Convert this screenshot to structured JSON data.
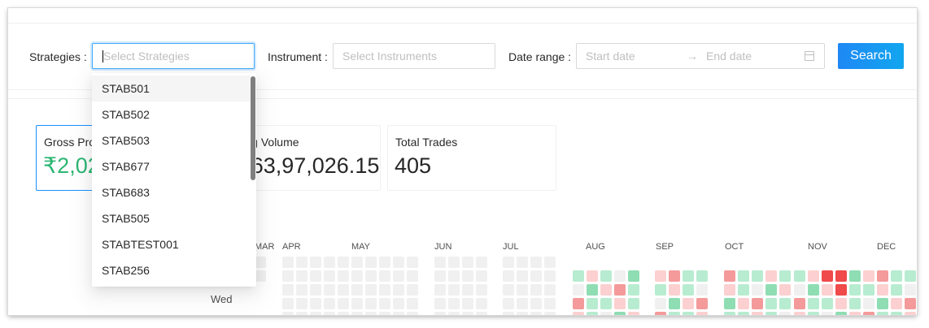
{
  "filters": {
    "strategies_label": "Strategies",
    "strategies_placeholder": "Select Strategies",
    "instrument_label": "Instrument",
    "instrument_placeholder": "Select Instruments",
    "date_range_label": "Date range",
    "start_placeholder": "Start date",
    "end_placeholder": "End date",
    "range_arrow": "→",
    "search_label": "Search"
  },
  "dropdown": {
    "options": [
      "STAB501",
      "STAB502",
      "STAB503",
      "STAB677",
      "STAB683",
      "STAB505",
      "STABTEST001",
      "STAB256"
    ],
    "active_index": 0
  },
  "stats": [
    {
      "title": "Gross Profit",
      "value": "₹2,02",
      "accent": "#2bb673"
    },
    {
      "title": "Trading Volume",
      "value": "₹1,63,97,026.15"
    },
    {
      "title": "Total Trades",
      "value": "405"
    }
  ],
  "heatmap": {
    "months": [
      "MAR",
      "APR",
      "MAY",
      "JUN",
      "JUL",
      "AUG",
      "SEP",
      "OCT",
      "NOV",
      "DEC"
    ],
    "day_label": "Wed",
    "colors": {
      "empty": "#f0f0f0",
      "gain_light": "#b7ecd0",
      "gain_mid": "#8fddb3",
      "loss_light": "#fcd0d0",
      "loss_mid": "#f49a9a",
      "loss_strong": "#f04a4a"
    }
  },
  "colors": {
    "accent": "#1890ff",
    "profit": "#2bb673"
  }
}
